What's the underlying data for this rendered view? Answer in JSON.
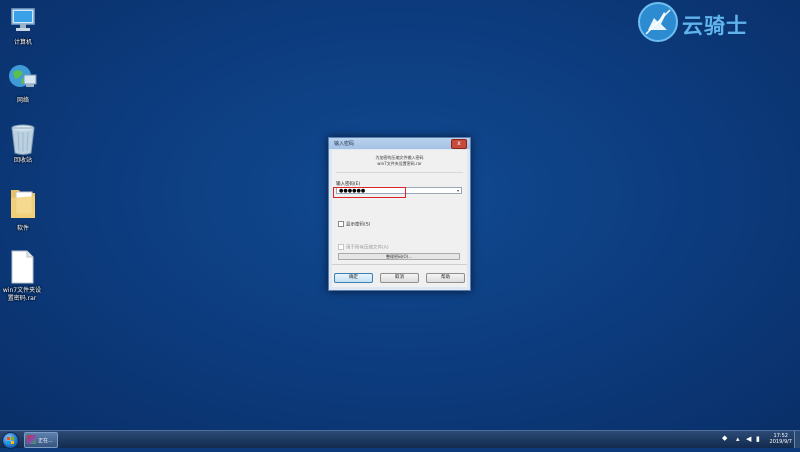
{
  "desktop": {
    "icons": [
      {
        "label": "计算机",
        "icon": "computer-icon"
      },
      {
        "label": "网络",
        "icon": "network-globe-icon"
      },
      {
        "label": "回收站",
        "icon": "recycle-bin-icon"
      },
      {
        "label": "软件",
        "icon": "folder-icon"
      },
      {
        "label": "win7文件夹设置密码.rar",
        "icon": "rar-file-icon"
      }
    ]
  },
  "logo": {
    "text": "云骑士"
  },
  "dialog": {
    "title": "输入密码",
    "close_label": "x",
    "info_line1": "为加密的压缩文件输入密码",
    "info_line2": "win7文件夹设置密码.rar",
    "password_label": "输入密码(E)",
    "password_value": "●●●●●●",
    "show_password_label": "显示密码(S)",
    "use_for_all_label": "用于所有压缩文件(A)",
    "organize_button": "整理密码(O)...",
    "ok_button": "确定",
    "cancel_button": "取消",
    "help_button": "帮助"
  },
  "taskbar": {
    "app_label": "正在...",
    "clock_time": "17:52",
    "clock_date": "2019/9/7"
  },
  "colors": {
    "desktop": "#0c3b7d",
    "highlight": "#d9252a",
    "logo": "#5fb4ec"
  }
}
